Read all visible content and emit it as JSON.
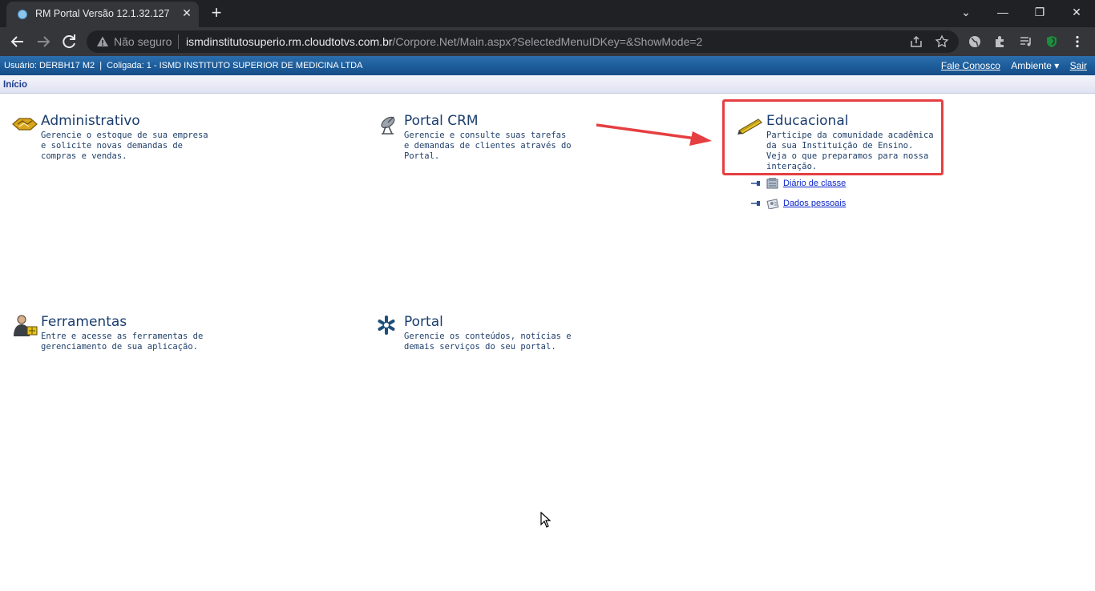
{
  "browser": {
    "tab_title": "RM Portal Versão 12.1.32.127",
    "tab_close": "✕",
    "new_tab": "+",
    "not_secure": "Não seguro",
    "url_host": "ismdinstitutosuperio.rm.cloudtotvs.com.br",
    "url_path": "/Corpore.Net/Main.aspx?SelectedMenuIDKey=&ShowMode=2",
    "window_controls": {
      "tab_search": "⌄",
      "minimize": "—",
      "restore": "❐",
      "close": "✕"
    }
  },
  "portal": {
    "user_info": "Usuário: DERBH17 M2  |  Coligada: 1 - ISMD INSTITUTO SUPERIOR DE MEDICINA LTDA",
    "links": {
      "contact": "Fale Conosco",
      "environment": "Ambiente ▾",
      "logout": "Sair"
    },
    "breadcrumb": "Início",
    "modules": {
      "administrativo": {
        "title": "Administrativo",
        "description": "Gerencie o estoque de sua empresa e solicite novas demandas de compras e vendas."
      },
      "crm": {
        "title": "Portal CRM",
        "description": "Gerencie e consulte suas tarefas e demandas de clientes através do Portal."
      },
      "educacional": {
        "title": "Educacional",
        "description": "Participe da comunidade acadêmica da sua Instituição de Ensino. Veja o que preparamos para nossa interação.",
        "sublinks": [
          "Diário de classe",
          "Dados pessoais"
        ]
      },
      "ferramentas": {
        "title": "Ferramentas",
        "description": "Entre e acesse as ferramentas de gerenciamento de sua aplicação."
      },
      "portal": {
        "title": "Portal",
        "description": "Gerencie os conteúdos, notícias e demais serviços do seu portal."
      }
    },
    "annotation_color": "#e53f41"
  }
}
